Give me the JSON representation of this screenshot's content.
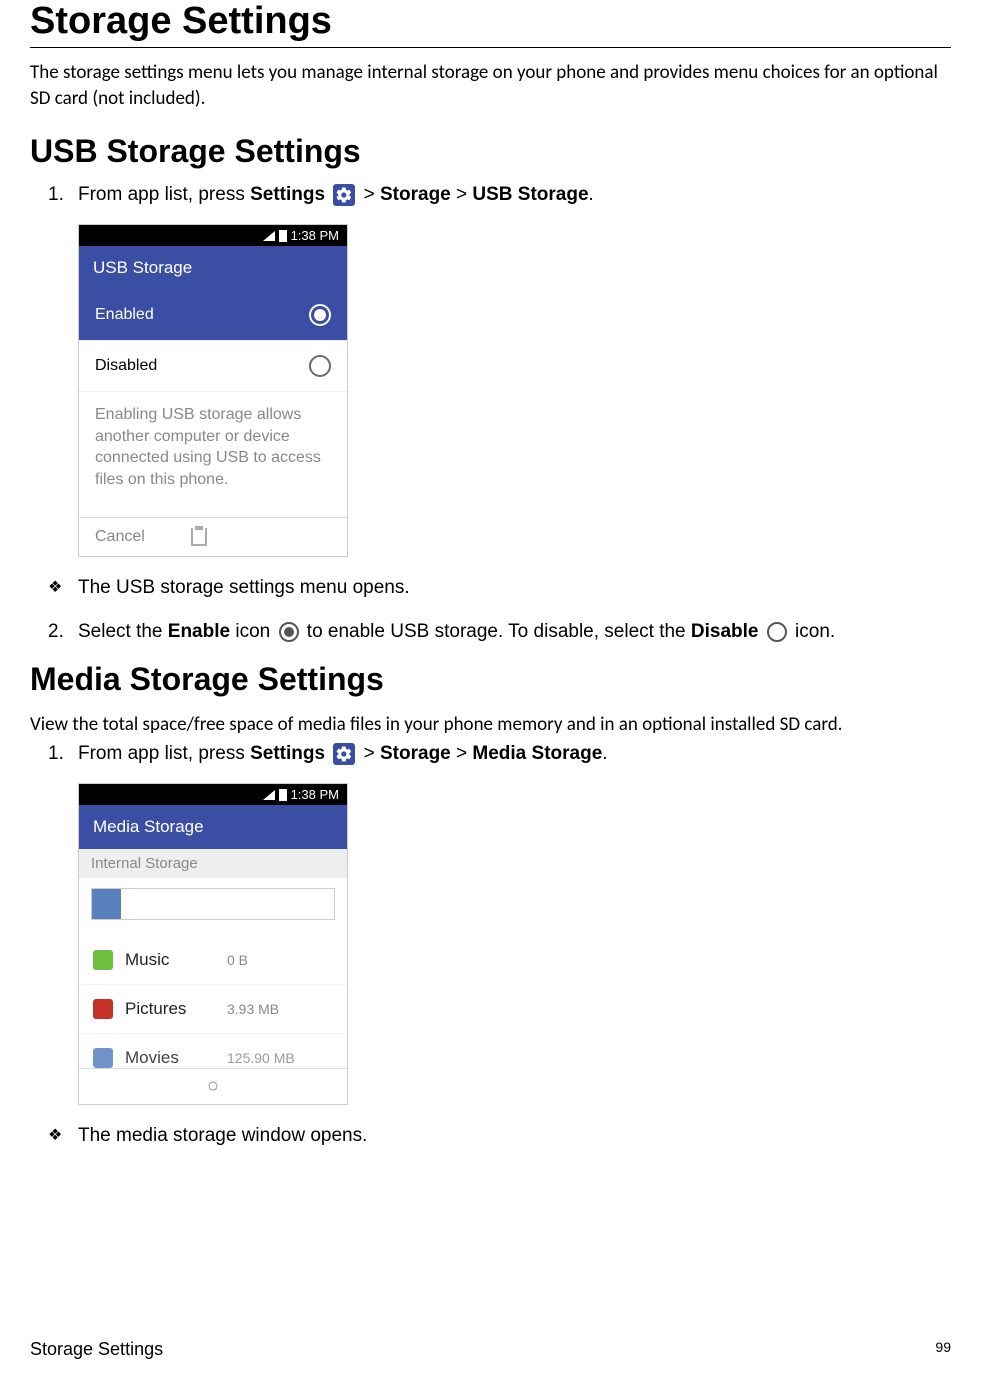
{
  "title": "Storage Settings",
  "intro": "The storage settings menu lets you manage internal storage on your phone and provides menu choices for an optional SD card (not included).",
  "usb": {
    "heading": "USB Storage Settings",
    "step1_prefix": "From app list, press ",
    "step1_settings": "Settings",
    "step1_mid": "  > ",
    "step1_storage": "Storage",
    "step1_sep": " > ",
    "step1_usb": "USB Storage",
    "step1_suffix": ".",
    "bullet": "The USB storage settings menu opens.",
    "step2_prefix": "Select the ",
    "step2_enable": "Enable",
    "step2_mid": " icon ",
    "step2_mid2": "  to enable USB storage. To disable, select the ",
    "step2_disable": "Disable",
    "step2_suffix": " icon."
  },
  "usb_phone": {
    "time": "1:38 PM",
    "header": "USB Storage",
    "enabled": "Enabled",
    "disabled": "Disabled",
    "explain": "Enabling USB storage allows another computer or device connected using USB to access files on this phone.",
    "cancel": "Cancel"
  },
  "media": {
    "heading": "Media Storage Settings",
    "intro": "View the total space/free space of media files in your phone memory and in an optional installed SD card.",
    "step1_prefix": "From app list, press ",
    "step1_settings": "Settings",
    "step1_mid": "  > ",
    "step1_storage": "Storage",
    "step1_sep": " > ",
    "step1_ms": "Media Storage",
    "step1_suffix": ".",
    "bullet": "The media storage window opens."
  },
  "media_phone": {
    "time": "1:38 PM",
    "header": "Media Storage",
    "sub": "Internal Storage",
    "music_label": "Music",
    "music_val": "0 B",
    "pictures_label": "Pictures",
    "pictures_val": "3.93 MB",
    "movies_label": "Movies",
    "movies_val": "125.90 MB",
    "colors": {
      "music": "#6fbf3e",
      "pictures": "#c43127",
      "movies": "#5a7fbf",
      "used": "#5a7fbf"
    }
  },
  "footer": {
    "left": "Storage Settings",
    "page": "99"
  }
}
